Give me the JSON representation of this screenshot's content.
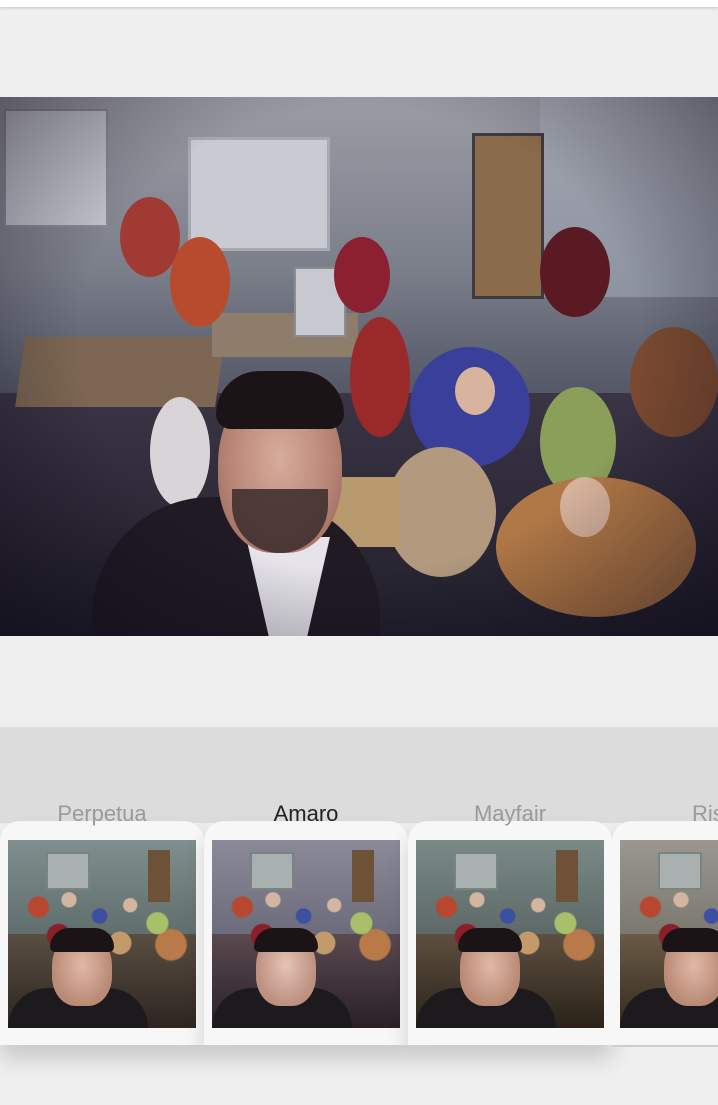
{
  "filters": {
    "items": [
      {
        "name": "Perpetua",
        "selected": false
      },
      {
        "name": "Amaro",
        "selected": true
      },
      {
        "name": "Mayfair",
        "selected": false
      },
      {
        "name": "Rise",
        "selected": false
      }
    ]
  },
  "colors": {
    "background": "#efefef",
    "panel": "#dcdcdc",
    "label_inactive": "#9a9a9a",
    "label_selected": "#222222"
  }
}
